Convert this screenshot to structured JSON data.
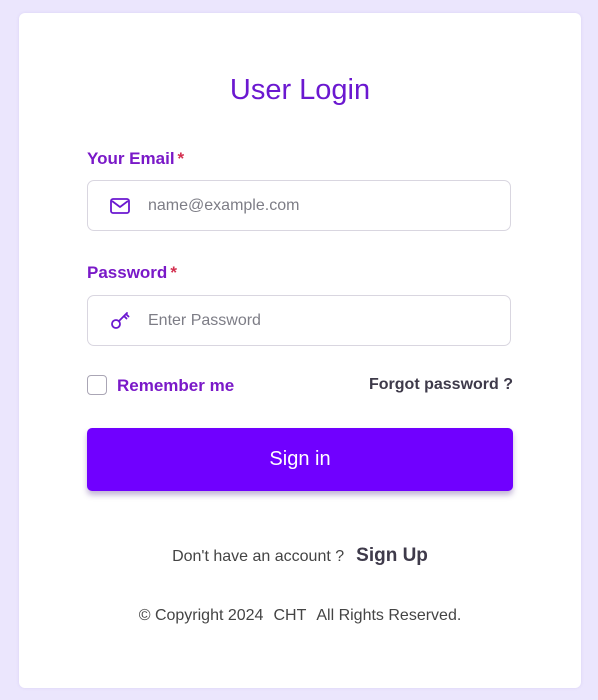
{
  "login": {
    "title": "User Login",
    "email_label": "Your Email",
    "password_label": "Password",
    "required_mark": "*",
    "email_placeholder": "name@example.com",
    "password_placeholder": "Enter Password",
    "remember_label": "Remember me",
    "remember_checked": false,
    "forgot_label": "Forgot password ?",
    "signin_label": "Sign in",
    "no_account_text": "Don't have an account ?",
    "signup_label": "Sign Up"
  },
  "footer": {
    "copyright": "© Copyright 2024",
    "company": "CHT",
    "rights": "All Rights Reserved."
  },
  "icons": {
    "email": "mail-icon",
    "password": "key-icon"
  },
  "colors": {
    "accent": "#7000ff",
    "label": "#7a19c8",
    "required": "#d32f4f",
    "background": "#ebe6fd"
  }
}
